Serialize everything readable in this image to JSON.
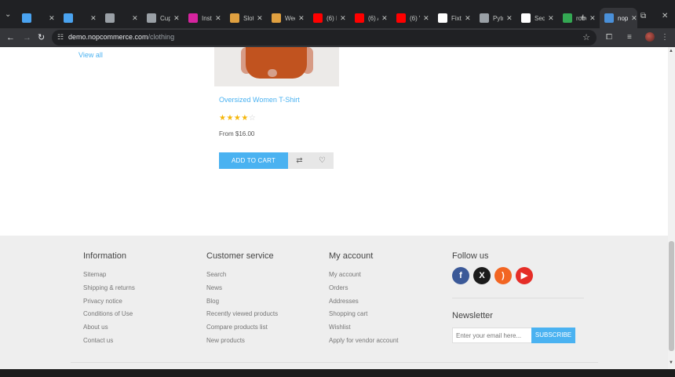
{
  "browser": {
    "tabs": [
      {
        "title": "",
        "favicon_color": "#4aa3f0"
      },
      {
        "title": "",
        "favicon_color": "#4aa3f0"
      },
      {
        "title": "",
        "favicon_color": "#9aa0a6",
        "icon": "speaker-icon"
      },
      {
        "title": "Cup",
        "favicon_color": "#9aa0a6"
      },
      {
        "title": "Insta",
        "favicon_color": "#d6249f"
      },
      {
        "title": "Slot",
        "favicon_color": "#e0a040"
      },
      {
        "title": "Wed",
        "favicon_color": "#e0a040"
      },
      {
        "title": "(6) F",
        "favicon_color": "#ff0000"
      },
      {
        "title": "(6) A",
        "favicon_color": "#ff0000"
      },
      {
        "title": "(6) V",
        "favicon_color": "#ff0000"
      },
      {
        "title": "Fixtu",
        "favicon_color": "#ffffff"
      },
      {
        "title": "Pyto",
        "favicon_color": "#9aa0a6"
      },
      {
        "title": "Sequ",
        "favicon_color": "#ffffff"
      },
      {
        "title": "robo",
        "favicon_color": "#34a853"
      },
      {
        "title": "nop",
        "favicon_color": "#4a90d9",
        "active": true
      }
    ],
    "url_host": "demo.nopcommerce.com",
    "url_path": "/clothing"
  },
  "sidebar": {
    "view_all": "View all"
  },
  "product": {
    "title": "Oversized Women T-Shirt",
    "rating": 4,
    "rating_max": 5,
    "stars_on": "★★★★",
    "stars_off": "☆",
    "price": "From $16.00",
    "add_to_cart": "ADD TO CART"
  },
  "footer": {
    "information": {
      "title": "Information",
      "links": [
        "Sitemap",
        "Shipping & returns",
        "Privacy notice",
        "Conditions of Use",
        "About us",
        "Contact us"
      ]
    },
    "customer_service": {
      "title": "Customer service",
      "links": [
        "Search",
        "News",
        "Blog",
        "Recently viewed products",
        "Compare products list",
        "New products"
      ]
    },
    "my_account": {
      "title": "My account",
      "links": [
        "My account",
        "Orders",
        "Addresses",
        "Shopping cart",
        "Wishlist",
        "Apply for vendor account"
      ]
    },
    "follow_us": {
      "title": "Follow us",
      "networks": [
        {
          "name": "facebook-icon",
          "glyph": "f",
          "color": "#3b5998"
        },
        {
          "name": "x-icon",
          "glyph": "X",
          "color": "#1b1b1b"
        },
        {
          "name": "rss-icon",
          "glyph": ")",
          "color": "#f26522"
        },
        {
          "name": "youtube-icon",
          "glyph": "▶",
          "color": "#e52d27"
        }
      ]
    },
    "newsletter": {
      "title": "Newsletter",
      "placeholder": "Enter your email here...",
      "subscribe": "SUBSCRIBE"
    }
  }
}
